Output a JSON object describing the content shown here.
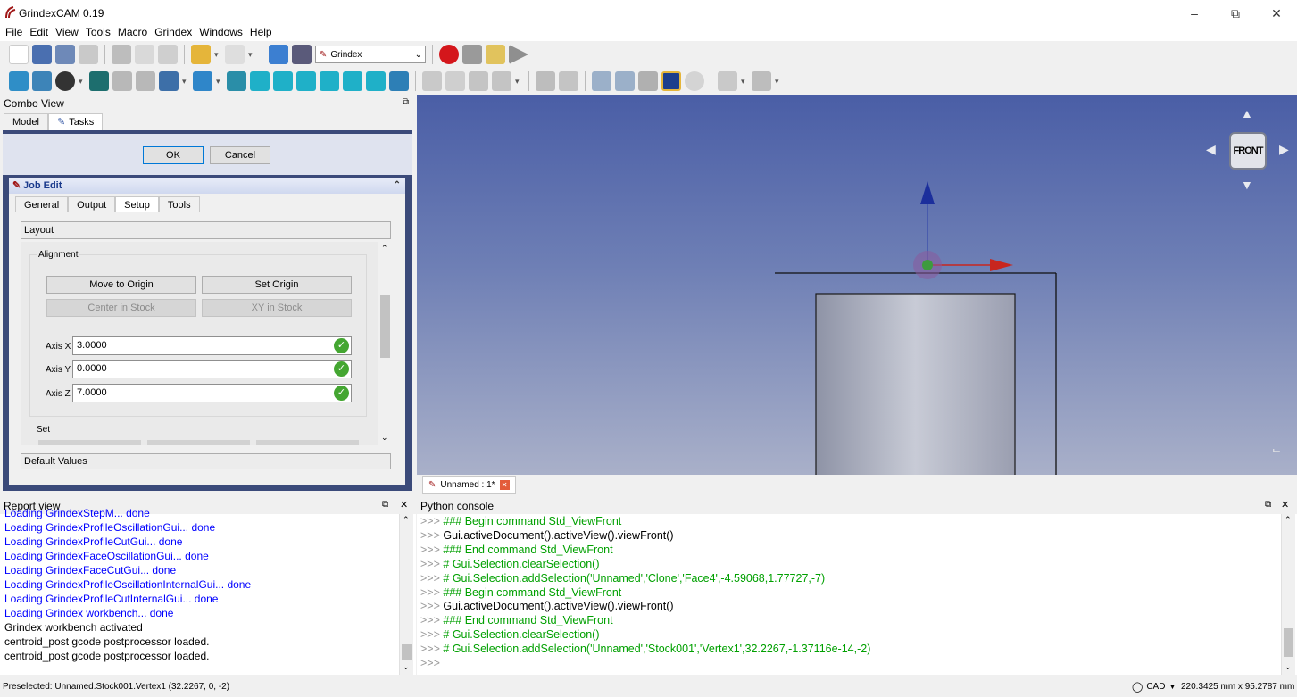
{
  "window": {
    "title": "GrindexCAM 0.19"
  },
  "menu": [
    "File",
    "Edit",
    "View",
    "Tools",
    "Macro",
    "Grindex",
    "Windows",
    "Help"
  ],
  "toolbar": {
    "workbench": "Grindex"
  },
  "combo": {
    "title": "Combo View",
    "tabs": [
      "Model",
      "Tasks"
    ]
  },
  "task": {
    "ok": "OK",
    "cancel": "Cancel"
  },
  "job": {
    "title": "Job Edit",
    "tabs": [
      "General",
      "Output",
      "Setup",
      "Tools"
    ],
    "active_tab": "Setup",
    "layout_label": "Layout",
    "alignment_label": "Alignment",
    "move_origin": "Move to Origin",
    "set_origin": "Set Origin",
    "center_stock": "Center in Stock",
    "xy_stock": "XY in Stock",
    "axes": [
      {
        "label": "Axis X",
        "value": "3.0000"
      },
      {
        "label": "Axis Y",
        "value": "0.0000"
      },
      {
        "label": "Axis Z",
        "value": "7.0000"
      }
    ],
    "set_label": "Set",
    "default_values": "Default Values"
  },
  "viewport": {
    "navcube_face": "FRONT",
    "doc_tab": "Unnamed : 1*"
  },
  "report": {
    "title": "Report view",
    "lines": [
      {
        "text": "Loading GrindexStepM... done",
        "color": "blue"
      },
      {
        "text": "Loading GrindexProfileOscillationGui... done",
        "color": "blue"
      },
      {
        "text": "Loading GrindexProfileCutGui... done",
        "color": "blue"
      },
      {
        "text": "Loading GrindexFaceOscillationGui... done",
        "color": "blue"
      },
      {
        "text": "Loading GrindexFaceCutGui... done",
        "color": "blue"
      },
      {
        "text": "Loading GrindexProfileOscillationInternalGui... done",
        "color": "blue"
      },
      {
        "text": "Loading GrindexProfileCutInternalGui... done",
        "color": "blue"
      },
      {
        "text": "Loading Grindex workbench... done",
        "color": "blue"
      },
      {
        "text": "Grindex workbench activated",
        "color": "black"
      },
      {
        "text": "centroid_post gcode postprocessor loaded.",
        "color": "black"
      },
      {
        "text": "centroid_post gcode postprocessor loaded.",
        "color": "black"
      }
    ]
  },
  "console": {
    "title": "Python console",
    "prompt": ">>>",
    "lines": [
      {
        "text": "### Begin command Std_ViewFront",
        "color": "green"
      },
      {
        "text": "Gui.activeDocument().activeView().viewFront()",
        "color": "black"
      },
      {
        "text": "### End command Std_ViewFront",
        "color": "green"
      },
      {
        "text": "# Gui.Selection.clearSelection()",
        "color": "green"
      },
      {
        "text": "# Gui.Selection.addSelection('Unnamed','Clone','Face4',-4.59068,1.77727,-7)",
        "color": "green"
      },
      {
        "text": "### Begin command Std_ViewFront",
        "color": "green"
      },
      {
        "text": "Gui.activeDocument().activeView().viewFront()",
        "color": "black"
      },
      {
        "text": "### End command Std_ViewFront",
        "color": "green"
      },
      {
        "text": "# Gui.Selection.clearSelection()",
        "color": "green"
      },
      {
        "text": "# Gui.Selection.addSelection('Unnamed','Stock001','Vertex1',32.2267,-1.37116e-14,-2)",
        "color": "green"
      },
      {
        "text": "",
        "color": "black"
      }
    ]
  },
  "status": {
    "left": "Preselected: Unnamed.Stock001.Vertex1 (32.2267, 0, -2)",
    "nav_style": "CAD",
    "dims": "220.3425 mm x 95.2787 mm"
  },
  "colors": {
    "accent": "#0078d7",
    "log_blue": "#0000ff",
    "console_green": "#00a000",
    "viewport_top": "#4a5ea6"
  }
}
